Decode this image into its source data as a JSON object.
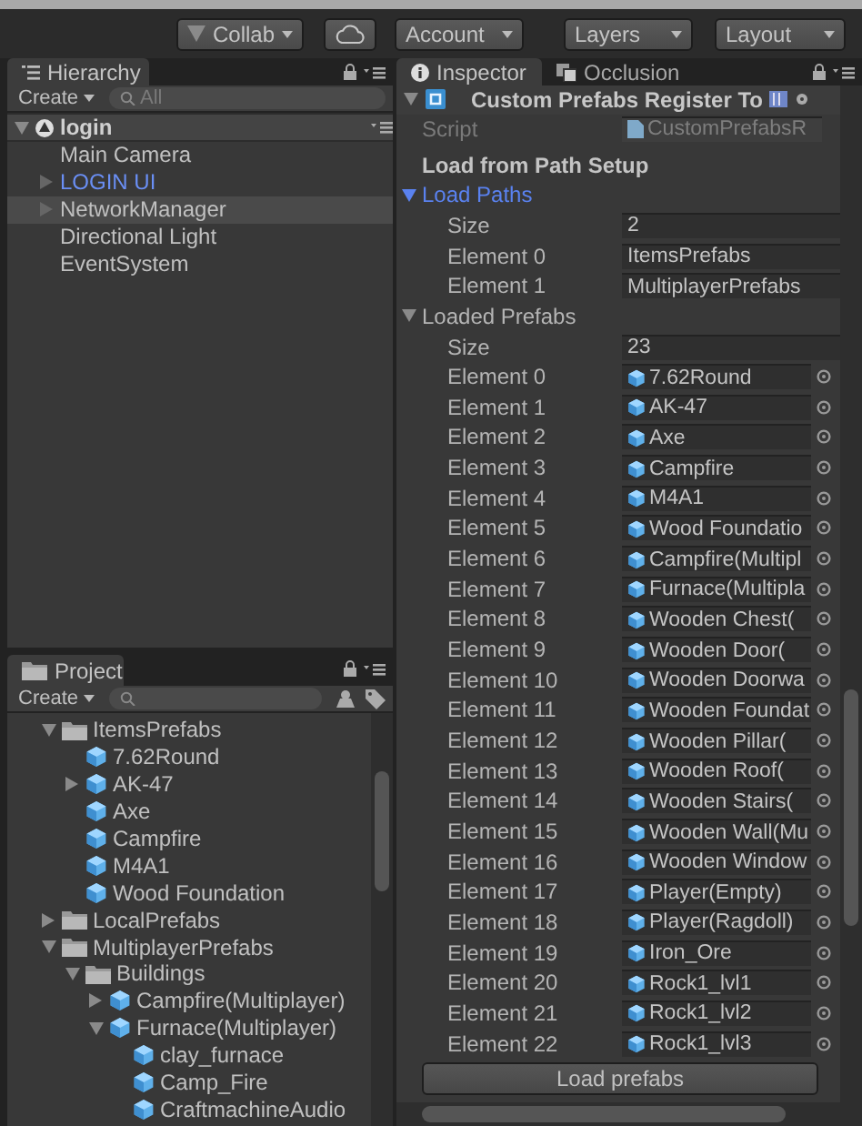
{
  "toolbar": [
    {
      "kind": "dropdown",
      "label": "Collab"
    },
    {
      "kind": "icon"
    },
    {
      "kind": "dropdown",
      "label": "Account"
    },
    {
      "kind": "dropdown",
      "label": "Layers"
    },
    {
      "kind": "dropdown",
      "label": "Layout"
    }
  ],
  "hierarchy": {
    "tab": "Hierarchy",
    "create": "Create",
    "search_placeholder": "All",
    "scene": {
      "name": "login",
      "expanded": true,
      "children": [
        {
          "name": "Main Camera",
          "kind": "object",
          "selected": false
        },
        {
          "name": "LOGIN UI",
          "kind": "prefab",
          "expanded": false,
          "selected": false
        },
        {
          "name": "NetworkManager",
          "kind": "object",
          "expanded": false,
          "selected": true
        },
        {
          "name": "Directional Light",
          "kind": "object",
          "selected": false
        },
        {
          "name": "EventSystem",
          "kind": "object",
          "selected": false
        }
      ]
    }
  },
  "project": {
    "tab": "Project",
    "create": "Create",
    "tree": [
      {
        "name": "ItemsPrefabs",
        "kind": "folder",
        "expanded": true,
        "children": [
          {
            "name": "7.62Round",
            "kind": "prefab"
          },
          {
            "name": "AK-47",
            "kind": "prefab",
            "expanded": false
          },
          {
            "name": "Axe",
            "kind": "prefab"
          },
          {
            "name": "Campfire",
            "kind": "prefab"
          },
          {
            "name": "M4A1",
            "kind": "prefab"
          },
          {
            "name": "Wood Foundation",
            "kind": "prefab"
          }
        ]
      },
      {
        "name": "LocalPrefabs",
        "kind": "folder",
        "expanded": false
      },
      {
        "name": "MultiplayerPrefabs",
        "kind": "folder",
        "expanded": true,
        "children": [
          {
            "name": "Buildings",
            "kind": "folder",
            "expanded": true,
            "children": [
              {
                "name": "Campfire(Multiplayer)",
                "kind": "prefab",
                "expanded": false
              },
              {
                "name": "Furnace(Multiplayer)",
                "kind": "prefab",
                "expanded": true,
                "children": [
                  {
                    "name": "clay_furnace",
                    "kind": "prefab"
                  },
                  {
                    "name": "Camp_Fire",
                    "kind": "prefab"
                  },
                  {
                    "name": "CraftmachineAudio",
                    "kind": "prefab"
                  }
                ]
              }
            ]
          }
        ]
      }
    ]
  },
  "inspector": {
    "tabs": [
      {
        "label": "Inspector",
        "selected": true
      },
      {
        "label": "Occlusion",
        "selected": false
      }
    ],
    "component": {
      "title": "Custom Prefabs Register To",
      "script_label": "Script",
      "script_value": "CustomPrefabsR"
    },
    "section": "Load from Path Setup",
    "arrays": [
      {
        "label": "Load Paths",
        "expanded": true,
        "focused": true,
        "size_label": "Size",
        "size": "2",
        "elements": [
          {
            "label": "Element 0",
            "kind": "text",
            "value": "ItemsPrefabs"
          },
          {
            "label": "Element 1",
            "kind": "text",
            "value": "MultiplayerPrefabs"
          }
        ]
      },
      {
        "label": "Loaded Prefabs",
        "expanded": true,
        "focused": false,
        "size_label": "Size",
        "size": "23",
        "elements": [
          {
            "label": "Element 0",
            "kind": "object",
            "value": "7.62Round"
          },
          {
            "label": "Element 1",
            "kind": "object",
            "value": "AK-47"
          },
          {
            "label": "Element 2",
            "kind": "object",
            "value": "Axe"
          },
          {
            "label": "Element 3",
            "kind": "object",
            "value": "Campfire"
          },
          {
            "label": "Element 4",
            "kind": "object",
            "value": "M4A1"
          },
          {
            "label": "Element 5",
            "kind": "object",
            "value": "Wood Foundatio"
          },
          {
            "label": "Element 6",
            "kind": "object",
            "value": "Campfire(Multipl"
          },
          {
            "label": "Element 7",
            "kind": "object",
            "value": "Furnace(Multipla"
          },
          {
            "label": "Element 8",
            "kind": "object",
            "value": "Wooden Chest("
          },
          {
            "label": "Element 9",
            "kind": "object",
            "value": "Wooden Door("
          },
          {
            "label": "Element 10",
            "kind": "object",
            "value": "Wooden Doorwa"
          },
          {
            "label": "Element 11",
            "kind": "object",
            "value": "Wooden Foundat"
          },
          {
            "label": "Element 12",
            "kind": "object",
            "value": "Wooden Pillar("
          },
          {
            "label": "Element 13",
            "kind": "object",
            "value": "Wooden Roof("
          },
          {
            "label": "Element 14",
            "kind": "object",
            "value": "Wooden Stairs("
          },
          {
            "label": "Element 15",
            "kind": "object",
            "value": "Wooden Wall(Mu"
          },
          {
            "label": "Element 16",
            "kind": "object",
            "value": "Wooden Window"
          },
          {
            "label": "Element 17",
            "kind": "object",
            "value": "Player(Empty)"
          },
          {
            "label": "Element 18",
            "kind": "object",
            "value": "Player(Ragdoll)"
          },
          {
            "label": "Element 19",
            "kind": "object",
            "value": "Iron_Ore"
          },
          {
            "label": "Element 20",
            "kind": "object",
            "value": "Rock1_lvl1"
          },
          {
            "label": "Element 21",
            "kind": "object",
            "value": "Rock1_lvl2"
          },
          {
            "label": "Element 22",
            "kind": "object",
            "value": "Rock1_lvl3"
          }
        ]
      }
    ],
    "button": "Load prefabs"
  }
}
